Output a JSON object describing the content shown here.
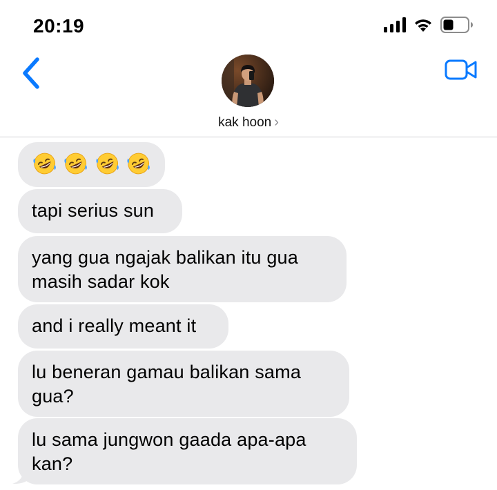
{
  "status_bar": {
    "time": "20:19"
  },
  "header": {
    "contact_name": "kak hoon",
    "chevron": "›"
  },
  "icons": {
    "back": "chevron-left-icon",
    "video": "video-camera-icon",
    "signal": "signal-bars-icon",
    "wifi": "wifi-icon",
    "battery": "battery-icon",
    "laugh": "rolling-on-floor-laughing-emoji"
  },
  "colors": {
    "accent": "#0a7aff",
    "bubble_gray": "#e9e9eb",
    "divider": "#cfcfd4"
  },
  "messages": [
    {
      "text": "",
      "emoji_count": 4
    },
    {
      "text": "tapi serius sun"
    },
    {
      "text": "yang gua ngajak balikan itu gua masih sadar kok"
    },
    {
      "text": "and i really meant it"
    },
    {
      "text": "lu beneran gamau balikan sama gua?"
    },
    {
      "text": "lu sama jungwon gaada apa-apa kan?"
    }
  ]
}
